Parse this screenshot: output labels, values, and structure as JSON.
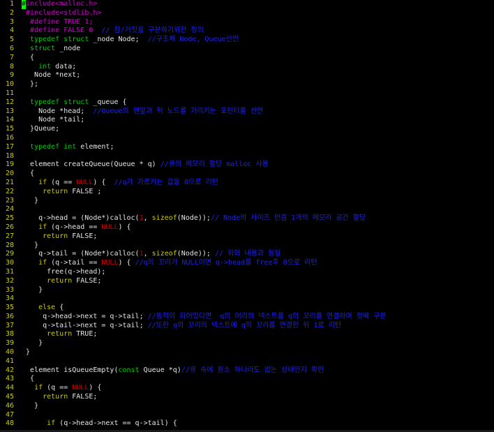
{
  "colors": {
    "background": "#000000",
    "line_number": "#cdcd00",
    "default": "#e5e5e5",
    "preproc": "#cd00cd",
    "type": "#00cd00",
    "keyword": "#cdcd00",
    "constant": "#cd0000",
    "comment": "#2020ee",
    "cursor": "#00ff00"
  },
  "lines": [
    {
      "n": "1",
      "segs": [
        {
          "c": "cursor",
          "t": "#"
        },
        {
          "c": "preproc",
          "t": "include<malloc.h>"
        }
      ]
    },
    {
      "n": "2",
      "segs": [
        {
          "c": "default",
          "t": " "
        },
        {
          "c": "preproc",
          "t": "#include<stdlib.h>"
        }
      ]
    },
    {
      "n": "3",
      "segs": [
        {
          "c": "default",
          "t": "  "
        },
        {
          "c": "preproc",
          "t": "#define TRUE 1;"
        }
      ]
    },
    {
      "n": "4",
      "segs": [
        {
          "c": "default",
          "t": "  "
        },
        {
          "c": "preproc",
          "t": "#define FALSE 0 "
        },
        {
          "c": "comment",
          "t": " // 참/거짓을 구분하기위한 정의"
        }
      ]
    },
    {
      "n": "5",
      "segs": [
        {
          "c": "default",
          "t": "  "
        },
        {
          "c": "type",
          "t": "typedef struct"
        },
        {
          "c": "default",
          "t": " _node Node; "
        },
        {
          "c": "comment",
          "t": " //구조체 Node, Queue선언"
        }
      ]
    },
    {
      "n": "6",
      "segs": [
        {
          "c": "default",
          "t": "  "
        },
        {
          "c": "type",
          "t": "struct"
        },
        {
          "c": "default",
          "t": " _node"
        }
      ]
    },
    {
      "n": "7",
      "segs": [
        {
          "c": "default",
          "t": "  {"
        }
      ]
    },
    {
      "n": "8",
      "segs": [
        {
          "c": "default",
          "t": "    "
        },
        {
          "c": "type",
          "t": "int"
        },
        {
          "c": "default",
          "t": " data;"
        }
      ]
    },
    {
      "n": "9",
      "segs": [
        {
          "c": "default",
          "t": "   Node *next;"
        }
      ]
    },
    {
      "n": "10",
      "segs": [
        {
          "c": "default",
          "t": "  };"
        }
      ]
    },
    {
      "n": "11",
      "segs": []
    },
    {
      "n": "12",
      "segs": [
        {
          "c": "default",
          "t": "  "
        },
        {
          "c": "type",
          "t": "typedef struct"
        },
        {
          "c": "default",
          "t": " _queue {"
        }
      ]
    },
    {
      "n": "13",
      "segs": [
        {
          "c": "default",
          "t": "    Node *head;  "
        },
        {
          "c": "comment",
          "t": "//Queue의 맨앞과 뒤 노드를 가리키는 포인터를 선언"
        }
      ]
    },
    {
      "n": "14",
      "segs": [
        {
          "c": "default",
          "t": "    Node *tail;"
        }
      ]
    },
    {
      "n": "15",
      "segs": [
        {
          "c": "default",
          "t": "  }Queue;"
        }
      ]
    },
    {
      "n": "16",
      "segs": []
    },
    {
      "n": "17",
      "segs": [
        {
          "c": "default",
          "t": "  "
        },
        {
          "c": "type",
          "t": "typedef int"
        },
        {
          "c": "default",
          "t": " element;"
        }
      ]
    },
    {
      "n": "18",
      "segs": []
    },
    {
      "n": "19",
      "segs": [
        {
          "c": "default",
          "t": "  element createQueue(Queue * q) "
        },
        {
          "c": "comment",
          "t": "//큐의 메모리 할당 malloc 사용"
        }
      ]
    },
    {
      "n": "20",
      "segs": [
        {
          "c": "default",
          "t": "  {"
        }
      ]
    },
    {
      "n": "21",
      "segs": [
        {
          "c": "default",
          "t": "    "
        },
        {
          "c": "keyword",
          "t": "if"
        },
        {
          "c": "default",
          "t": " (q == "
        },
        {
          "c": "constant",
          "t": "NULL"
        },
        {
          "c": "default",
          "t": ") {  "
        },
        {
          "c": "comment",
          "t": "//q가 가르키는 값을 0으로 리턴"
        }
      ]
    },
    {
      "n": "22",
      "segs": [
        {
          "c": "default",
          "t": "     "
        },
        {
          "c": "keyword",
          "t": "return"
        },
        {
          "c": "default",
          "t": " FALSE ;"
        }
      ]
    },
    {
      "n": "23",
      "segs": [
        {
          "c": "default",
          "t": "   }"
        }
      ]
    },
    {
      "n": "24",
      "segs": []
    },
    {
      "n": "25",
      "segs": [
        {
          "c": "default",
          "t": "    q->head = (Node*)calloc("
        },
        {
          "c": "constant",
          "t": "1"
        },
        {
          "c": "default",
          "t": ", "
        },
        {
          "c": "keyword",
          "t": "sizeof"
        },
        {
          "c": "default",
          "t": "(Node));"
        },
        {
          "c": "comment",
          "t": "// Node의 사이즈 만큼 1개의 메모리 공간 할당"
        }
      ]
    },
    {
      "n": "26",
      "segs": [
        {
          "c": "default",
          "t": "    "
        },
        {
          "c": "keyword",
          "t": "if"
        },
        {
          "c": "default",
          "t": " (q->head == "
        },
        {
          "c": "constant",
          "t": "NULL"
        },
        {
          "c": "default",
          "t": ") {"
        }
      ]
    },
    {
      "n": "27",
      "segs": [
        {
          "c": "default",
          "t": "     "
        },
        {
          "c": "keyword",
          "t": "return"
        },
        {
          "c": "default",
          "t": " FALSE;"
        }
      ]
    },
    {
      "n": "28",
      "segs": [
        {
          "c": "default",
          "t": "   }"
        }
      ]
    },
    {
      "n": "29",
      "segs": [
        {
          "c": "default",
          "t": "    q->tail = (Node*)calloc("
        },
        {
          "c": "constant",
          "t": "1"
        },
        {
          "c": "default",
          "t": ", "
        },
        {
          "c": "keyword",
          "t": "sizeof"
        },
        {
          "c": "default",
          "t": "(Node)); "
        },
        {
          "c": "comment",
          "t": "// 위와 내용과 동일"
        }
      ]
    },
    {
      "n": "30",
      "segs": [
        {
          "c": "default",
          "t": "    "
        },
        {
          "c": "keyword",
          "t": "if"
        },
        {
          "c": "default",
          "t": " (q->tail == "
        },
        {
          "c": "constant",
          "t": "NULL"
        },
        {
          "c": "default",
          "t": ") { "
        },
        {
          "c": "comment",
          "t": "//q의 꼬리가 NULL이면 q->head를 free후 0으로 리턴"
        }
      ]
    },
    {
      "n": "31",
      "segs": [
        {
          "c": "default",
          "t": "      free(q->head);"
        }
      ]
    },
    {
      "n": "32",
      "segs": [
        {
          "c": "default",
          "t": "      "
        },
        {
          "c": "keyword",
          "t": "return"
        },
        {
          "c": "default",
          "t": " FALSE;"
        }
      ]
    },
    {
      "n": "33",
      "segs": [
        {
          "c": "default",
          "t": "    }"
        }
      ]
    },
    {
      "n": "34",
      "segs": []
    },
    {
      "n": "35",
      "segs": [
        {
          "c": "default",
          "t": "    "
        },
        {
          "c": "keyword",
          "t": "else"
        },
        {
          "c": "default",
          "t": " {"
        }
      ]
    },
    {
      "n": "36",
      "segs": [
        {
          "c": "default",
          "t": "     q->head->next = q->tail; "
        },
        {
          "c": "comment",
          "t": "//동적이 되어있다면  q의 머리의 넥스트를 q의 꼬리를 연결하여 첫째 구문"
        }
      ]
    },
    {
      "n": "37",
      "segs": [
        {
          "c": "default",
          "t": "     q->tail->next = q->tail; "
        },
        {
          "c": "comment",
          "t": "//또한 q의 꼬리의 넥스트에 q의 꼬리를 연결한 뒤 1로 리턴"
        }
      ]
    },
    {
      "n": "38",
      "segs": [
        {
          "c": "default",
          "t": "      "
        },
        {
          "c": "keyword",
          "t": "return"
        },
        {
          "c": "default",
          "t": " TRUE;"
        }
      ]
    },
    {
      "n": "39",
      "segs": [
        {
          "c": "default",
          "t": "    }"
        }
      ]
    },
    {
      "n": "40",
      "segs": [
        {
          "c": "default",
          "t": " }"
        }
      ]
    },
    {
      "n": "41",
      "segs": []
    },
    {
      "n": "42",
      "segs": [
        {
          "c": "default",
          "t": "  element isQueueEmpty("
        },
        {
          "c": "type",
          "t": "const"
        },
        {
          "c": "default",
          "t": " Queue *q)"
        },
        {
          "c": "comment",
          "t": "//큐 속에 원소 하나라도 없는 상태인지 확인"
        }
      ]
    },
    {
      "n": "43",
      "segs": [
        {
          "c": "default",
          "t": "  {"
        }
      ]
    },
    {
      "n": "44",
      "segs": [
        {
          "c": "default",
          "t": "   "
        },
        {
          "c": "keyword",
          "t": "if"
        },
        {
          "c": "default",
          "t": " (q == "
        },
        {
          "c": "constant",
          "t": "NULL"
        },
        {
          "c": "default",
          "t": ") {"
        }
      ]
    },
    {
      "n": "45",
      "segs": [
        {
          "c": "default",
          "t": "     "
        },
        {
          "c": "keyword",
          "t": "return"
        },
        {
          "c": "default",
          "t": " FALSE;"
        }
      ]
    },
    {
      "n": "46",
      "segs": [
        {
          "c": "default",
          "t": "   }"
        }
      ]
    },
    {
      "n": "47",
      "segs": []
    },
    {
      "n": "48",
      "segs": [
        {
          "c": "default",
          "t": "      "
        },
        {
          "c": "keyword",
          "t": "if"
        },
        {
          "c": "default",
          "t": " (q->head->next == q->tail) {"
        }
      ]
    }
  ]
}
